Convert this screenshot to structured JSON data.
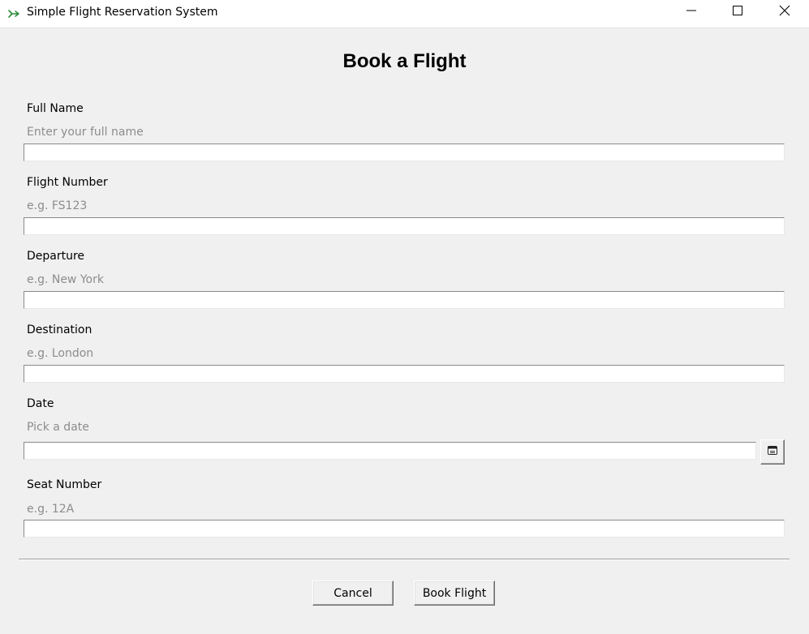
{
  "window": {
    "title": "Simple Flight Reservation System",
    "app_icon": "plane-icon",
    "controls": {
      "minimize": "minimize-icon",
      "maximize": "maximize-icon",
      "close": "close-icon"
    }
  },
  "heading": "Book a Flight",
  "fields": [
    {
      "label": "Full Name",
      "hint": "Enter your full name",
      "value": ""
    },
    {
      "label": "Flight Number",
      "hint": "e.g. FS123",
      "value": ""
    },
    {
      "label": "Departure",
      "hint": "e.g. New York",
      "value": ""
    },
    {
      "label": "Destination",
      "hint": "e.g. London",
      "value": ""
    },
    {
      "label": "Date",
      "hint": "Pick a date",
      "value": "",
      "picker_icon": "calendar-icon"
    },
    {
      "label": "Seat Number",
      "hint": "e.g. 12A",
      "value": ""
    }
  ],
  "buttons": {
    "cancel": "Cancel",
    "book": "Book Flight"
  },
  "colors": {
    "background": "#f0f0f0",
    "hint_text": "#8c8c8c",
    "input_background": "#ffffff",
    "app_icon_accent": "#2e8b3a"
  }
}
